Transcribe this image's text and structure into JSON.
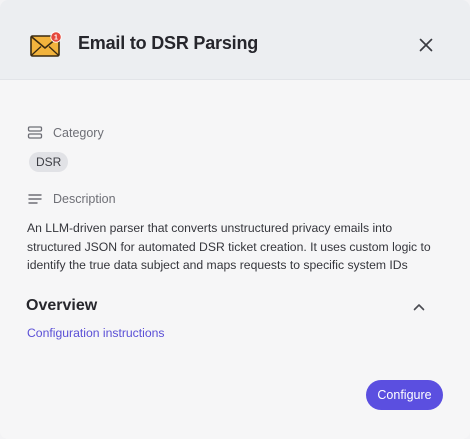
{
  "header": {
    "title": "Email to DSR Parsing",
    "app_icon": "envelope-notification-icon",
    "notification_count": "1",
    "close_icon": "close-icon"
  },
  "category": {
    "label": "Category",
    "icon": "stack-icon",
    "chip": "DSR"
  },
  "description": {
    "label": "Description",
    "icon": "text-lines-icon",
    "text": "An LLM-driven parser that converts unstructured privacy emails into structured JSON for automated DSR ticket creation. It uses custom logic to identify the true data subject and maps requests to specific system IDs"
  },
  "overview": {
    "title": "Overview",
    "toggle_icon": "chevron-up-icon",
    "link": "Configuration instructions"
  },
  "footer": {
    "configure_label": "Configure"
  },
  "colors": {
    "accent": "#5b4fe0",
    "link": "#5a4fd6",
    "badge": "#e5483c",
    "envelope": "#f2b33d"
  }
}
